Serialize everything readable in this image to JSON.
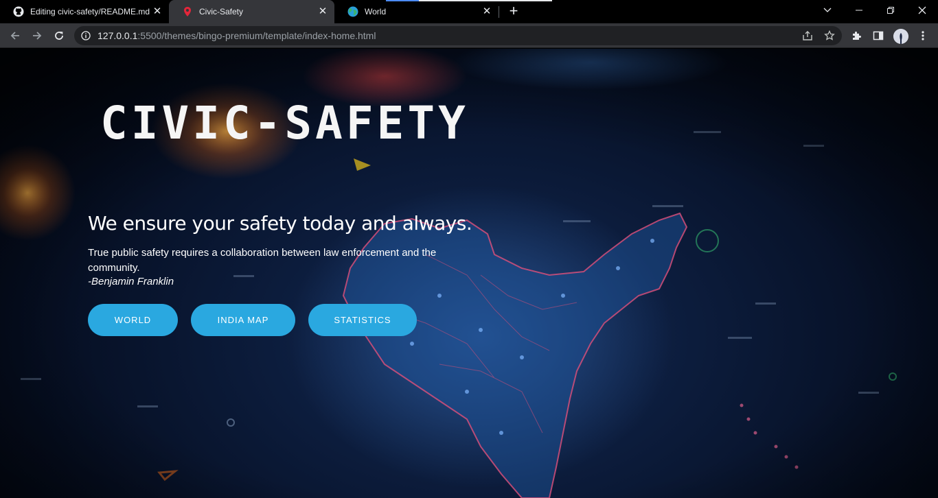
{
  "browser": {
    "tabs": [
      {
        "title": "Editing civic-safety/README.md",
        "favicon": "github-icon",
        "active": false
      },
      {
        "title": "Civic-Safety",
        "favicon": "map-pin-icon",
        "active": true
      },
      {
        "title": "World",
        "favicon": "globe-icon",
        "active": false
      }
    ],
    "close_glyph": "✕",
    "new_tab_glyph": "+",
    "address": {
      "host": "127.0.0.1",
      "rest": ":5500/themes/bingo-premium/template/index-home.html"
    }
  },
  "hero": {
    "brand": "CIVIC-SAFETY",
    "headline": "We ensure your safety today and always.",
    "quote": "True public safety requires a collaboration between law enforcement and the community.",
    "author": "-Benjamin Franklin",
    "buttons": {
      "world": "WORLD",
      "india_map": "INDIA MAP",
      "statistics": "STATISTICS"
    }
  },
  "colors": {
    "accent_button": "#2aa8e0",
    "active_tab": "#35363a",
    "map_land": "#1d4e8f",
    "map_border": "#e0507a"
  }
}
